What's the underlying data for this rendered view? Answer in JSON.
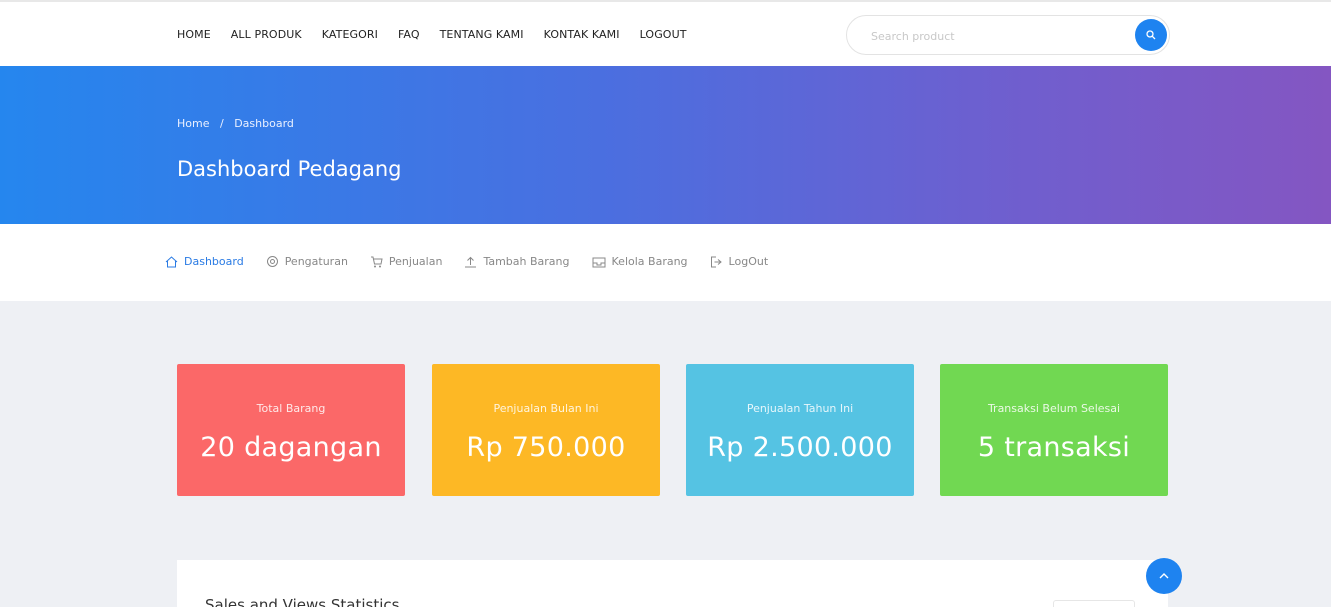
{
  "topnav": {
    "items": [
      {
        "label": "HOME"
      },
      {
        "label": "ALL PRODUK"
      },
      {
        "label": "KATEGORI"
      },
      {
        "label": "FAQ"
      },
      {
        "label": "TENTANG KAMI"
      },
      {
        "label": "KONTAK KAMI"
      },
      {
        "label": "LOGOUT"
      }
    ],
    "search": {
      "placeholder": "Search product",
      "icon": "search-icon"
    }
  },
  "hero": {
    "breadcrumb": {
      "home": "Home",
      "separator": "/",
      "current": "Dashboard"
    },
    "title": "Dashboard Pedagang"
  },
  "subnav": {
    "items": [
      {
        "label": "Dashboard",
        "icon": "home-icon",
        "active": true
      },
      {
        "label": "Pengaturan",
        "icon": "gear-icon",
        "active": false
      },
      {
        "label": "Penjualan",
        "icon": "cart-icon",
        "active": false
      },
      {
        "label": "Tambah Barang",
        "icon": "upload-icon",
        "active": false
      },
      {
        "label": "Kelola Barang",
        "icon": "box-icon",
        "active": false
      },
      {
        "label": "LogOut",
        "icon": "logout-icon",
        "active": false
      }
    ]
  },
  "cards": [
    {
      "label": "Total Barang",
      "value": "20 dagangan",
      "color": "#fb6868"
    },
    {
      "label": "Penjualan Bulan Ini",
      "value": "Rp 750.000",
      "color": "#fdb825"
    },
    {
      "label": "Penjualan Tahun Ini",
      "value": "Rp 2.500.000",
      "color": "#55c3e3"
    },
    {
      "label": "Transaksi Belum Selesai",
      "value": "5 transaksi",
      "color": "#71d852"
    }
  ],
  "stats_panel": {
    "title": "Sales and Views Statistics"
  },
  "colors": {
    "accent": "#1e83f0",
    "active_link": "#2a7be4"
  }
}
